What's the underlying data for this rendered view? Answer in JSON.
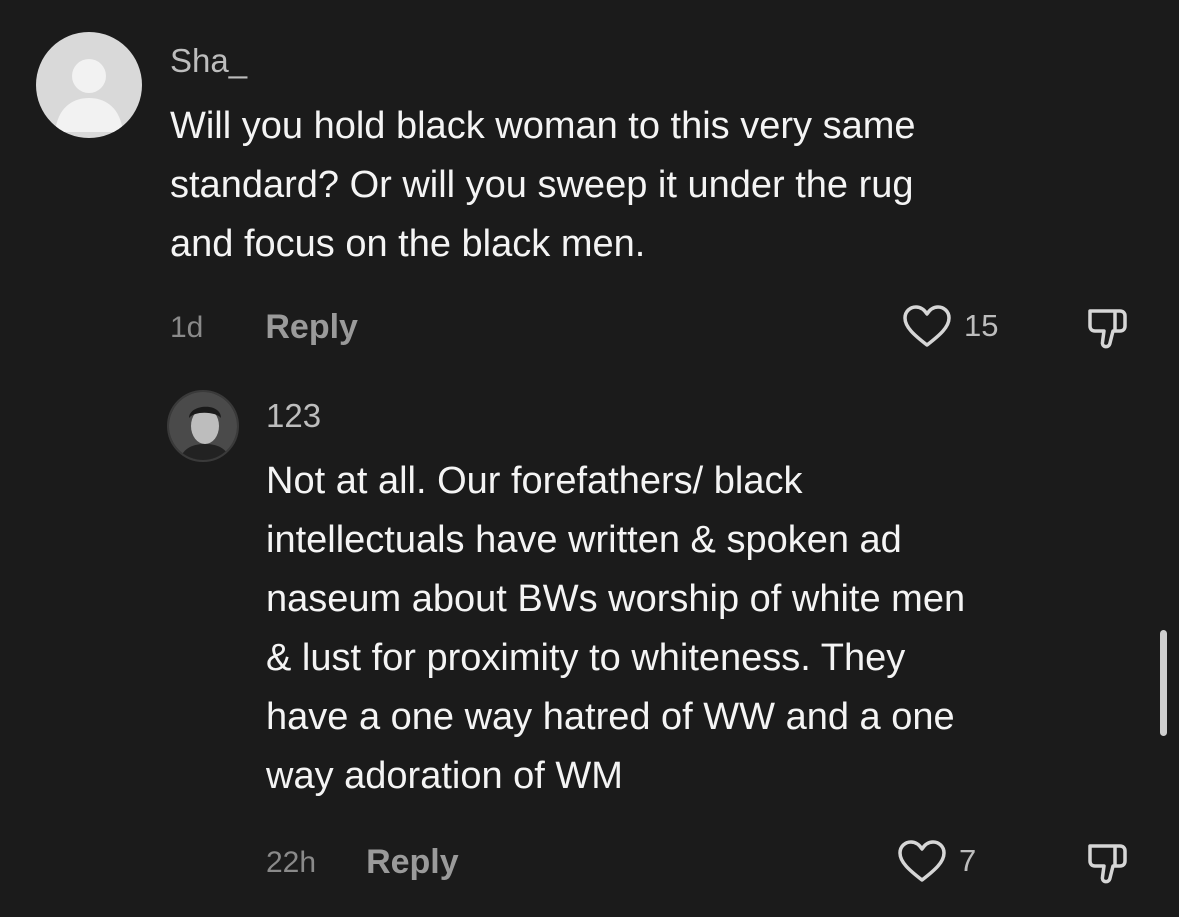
{
  "comments": [
    {
      "username": "Sha_",
      "lines": [
        "Will you hold black woman to this very same",
        "standard? Or will you sweep it under the rug",
        "and focus on the black men."
      ],
      "time": "1d",
      "reply_label": "Reply",
      "likes": "15"
    },
    {
      "username": "123",
      "lines": [
        "Not at all. Our forefathers/ black",
        "intellectuals have written & spoken ad",
        "naseum about BWs worship of white men",
        "& lust for proximity to whiteness. They",
        "have a one way hatred of WW and a one",
        "way adoration of WM"
      ],
      "time": "22h",
      "reply_label": "Reply",
      "likes": "7"
    }
  ],
  "colors": {
    "background": "#1b1b1b",
    "text": "#f4f4f4",
    "muted": "#8a8a8a"
  }
}
